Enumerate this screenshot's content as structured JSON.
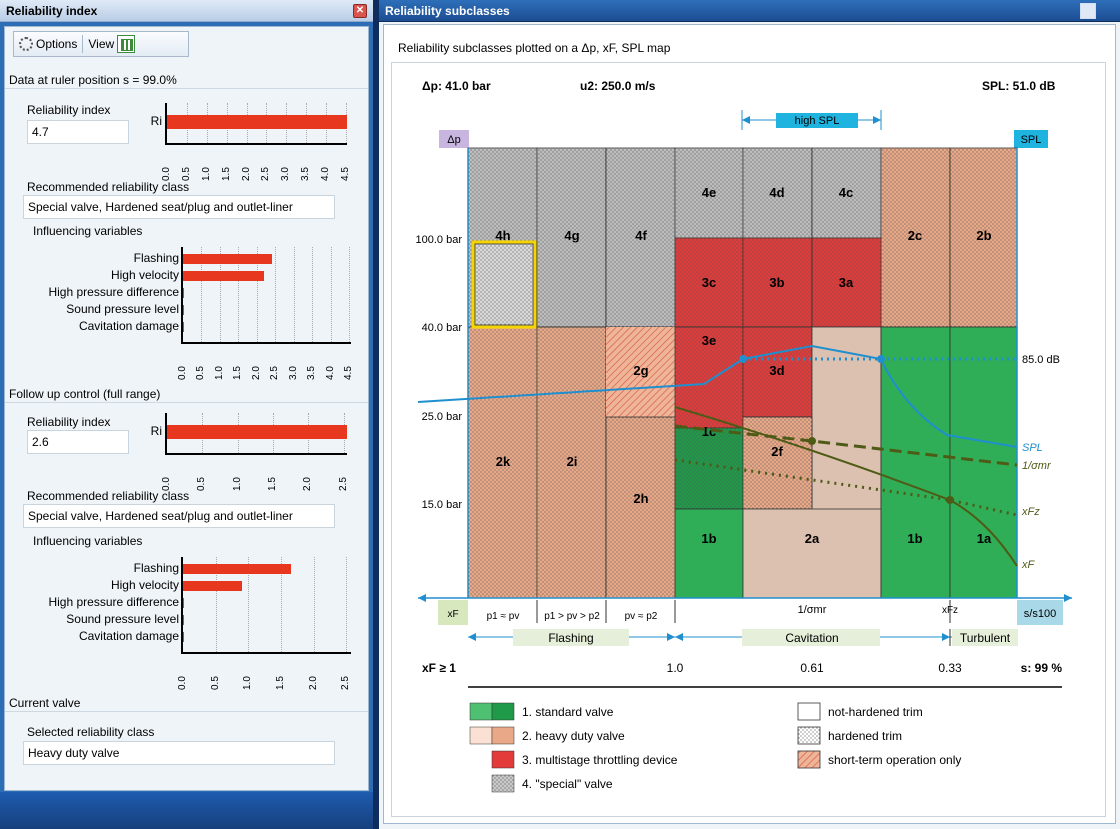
{
  "left_panel": {
    "title": "Reliability index",
    "toolbar": {
      "options": "Options",
      "view": "View"
    },
    "ruler": "Data at ruler position s = 99.0%",
    "section1": {
      "ri_label": "Reliability index",
      "ri_value": "4.7",
      "bar_label": "Ri",
      "ri_ticks": [
        "0.0",
        "0.5",
        "1.0",
        "1.5",
        "2.0",
        "2.5",
        "3.0",
        "3.5",
        "4.0",
        "4.5"
      ],
      "ri_fraction": 1.0,
      "class_label": "Recommended reliability class",
      "class_value": "Special valve, Hardened seat/plug and outlet-liner",
      "infl_label": "Influencing variables",
      "variables": [
        {
          "label": "Flashing",
          "value": 2.4
        },
        {
          "label": "High velocity",
          "value": 2.2
        },
        {
          "label": "High pressure difference",
          "value": 0
        },
        {
          "label": "Sound pressure level",
          "value": 0
        },
        {
          "label": "Cavitation damage",
          "value": 0
        }
      ],
      "infl_ticks": [
        "0.0",
        "0.5",
        "1.0",
        "1.5",
        "2.0",
        "2.5",
        "3.0",
        "3.5",
        "4.0",
        "4.5"
      ]
    },
    "followup": "Follow up control (full range)",
    "section2": {
      "ri_label": "Reliability index",
      "ri_value": "2.6",
      "bar_label": "Ri",
      "ri_ticks": [
        "0.0",
        "0.5",
        "1.0",
        "1.5",
        "2.0",
        "2.5"
      ],
      "ri_fraction": 1.0,
      "class_label": "Recommended reliability class",
      "class_value": "Special valve, Hardened seat/plug and outlet-liner",
      "infl_label": "Influencing variables",
      "variables": [
        {
          "label": "Flashing",
          "value": 1.65
        },
        {
          "label": "High velocity",
          "value": 0.9
        },
        {
          "label": "High pressure difference",
          "value": 0
        },
        {
          "label": "Sound pressure level",
          "value": 0
        },
        {
          "label": "Cavitation damage",
          "value": 0
        }
      ],
      "infl_ticks": [
        "0.0",
        "0.5",
        "1.0",
        "1.5",
        "2.0",
        "2.5"
      ]
    },
    "current": {
      "header": "Current valve",
      "label": "Selected reliability class",
      "value": "Heavy duty valve"
    }
  },
  "right_panel": {
    "title": "Reliability subclasses",
    "subtitle": "Reliability subclasses plotted on a Δp, xF, SPL map",
    "map": {
      "dp_header": "Δp: 41.0 bar",
      "u2_header": "u2: 250.0 m/s",
      "spl_header": "SPL: 51.0 dB",
      "high_spl": "high SPL",
      "dp_tag": "Δp",
      "spl_tag": "SPL",
      "y_labels": [
        "100.0 bar",
        "40.0 bar",
        "25.0 bar",
        "15.0 bar"
      ],
      "spl_value": "85.0 dB",
      "cells": [
        "4h",
        "4g",
        "4f",
        "4e",
        "4d",
        "4c",
        "2c",
        "2b",
        "3c",
        "3b",
        "3a",
        "3e",
        "3d",
        "2g",
        "1c",
        "2f",
        "2k",
        "2i",
        "2h",
        "1b",
        "2a",
        "1b",
        "1a"
      ],
      "curve_labels": {
        "spl": "SPL",
        "sigma": "1/σmr",
        "xfz": "xFz",
        "xf": "xF"
      },
      "bottom_axis": {
        "xf_tag": "xF",
        "s_tag": "s/s100",
        "sigma": "1/σmr",
        "xfz": "xFz",
        "zones": [
          "p1 ≈ pv",
          "p1 > pv > p2",
          "pv ≈ p2"
        ],
        "flashing": "Flashing",
        "cavitation": "Cavitation",
        "turbulent": "Turbulent"
      },
      "scale": {
        "start": "xF ≥ 1",
        "t1": "1.0",
        "t2": "0.61",
        "t3": "0.33",
        "end": "s: 99 %"
      },
      "legend": [
        "1. standard valve",
        "2. heavy duty valve",
        "3. multistage throttling device",
        "4. \"special\" valve",
        "not-hardened trim",
        "hardened trim",
        "short-term operation only"
      ]
    }
  },
  "colors": {
    "bar": "#e8371f",
    "green_dark": "#1e9a48",
    "green": "#2fae57",
    "salmon": "#e9a887",
    "red": "#e33a3a",
    "grey": "#bdbdbd",
    "spl_blue": "#1f8fcf",
    "curve_olive": "#4e5b16"
  }
}
